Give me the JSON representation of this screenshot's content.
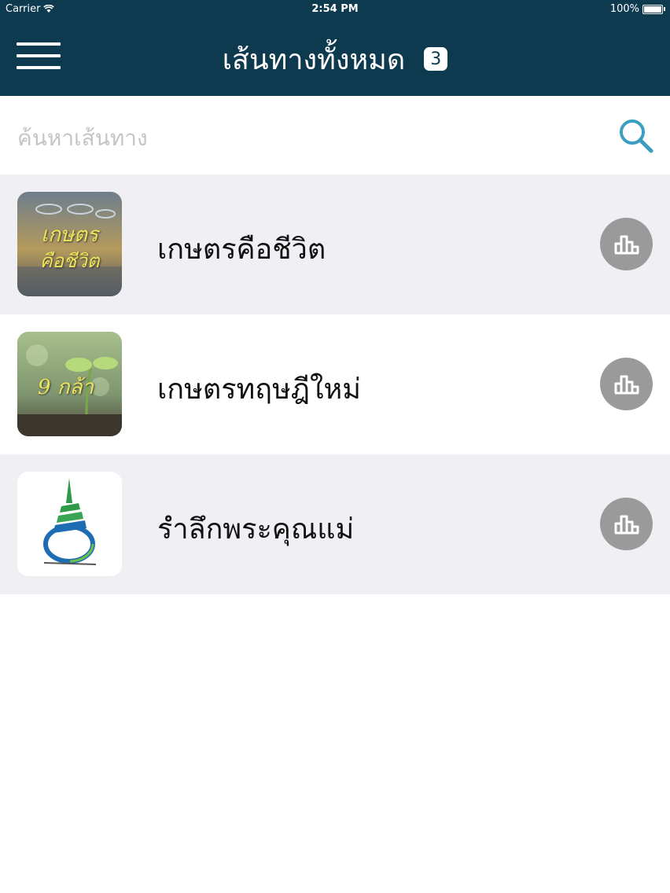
{
  "statusbar": {
    "carrier": "Carrier",
    "time": "2:54 PM",
    "battery": "100%"
  },
  "header": {
    "title": "เส้นทางทั้งหมด",
    "count": "3",
    "menu_icon": "hamburger-menu-icon"
  },
  "search": {
    "placeholder": "ค้นหาเส้นทาง",
    "value": "",
    "icon": "search-icon"
  },
  "routes": [
    {
      "label": "เกษตรคือชีวิต",
      "thumb_text": [
        "เกษตร",
        "คือชีวิต"
      ],
      "stats_icon": "bar-chart-icon"
    },
    {
      "label": "เกษตรทฤษฎีใหม่",
      "thumb_text": [
        "9 กล้า"
      ],
      "stats_icon": "bar-chart-icon"
    },
    {
      "label": "รำลึกพระคุณแม่",
      "stats_icon": "bar-chart-icon"
    }
  ],
  "colors": {
    "header_bg": "#0e3a4f",
    "accent": "#3b9dbf",
    "row_shade": "#f0eff4",
    "stats_button": "#9a9a9a"
  }
}
